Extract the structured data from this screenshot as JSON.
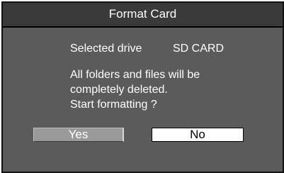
{
  "dialog": {
    "title": "Format Card",
    "drive_label": "Selected drive",
    "drive_value": "SD CARD",
    "message_lines": [
      "All folders and files will be",
      "completely deleted.",
      "Start formatting ?"
    ],
    "buttons": {
      "yes": "Yes",
      "no": "No"
    },
    "colors": {
      "title_bar": "#3a3a3a",
      "body": "#5b5b5b",
      "yes_button": "#9a9a9a",
      "no_button": "#ffffff"
    }
  }
}
